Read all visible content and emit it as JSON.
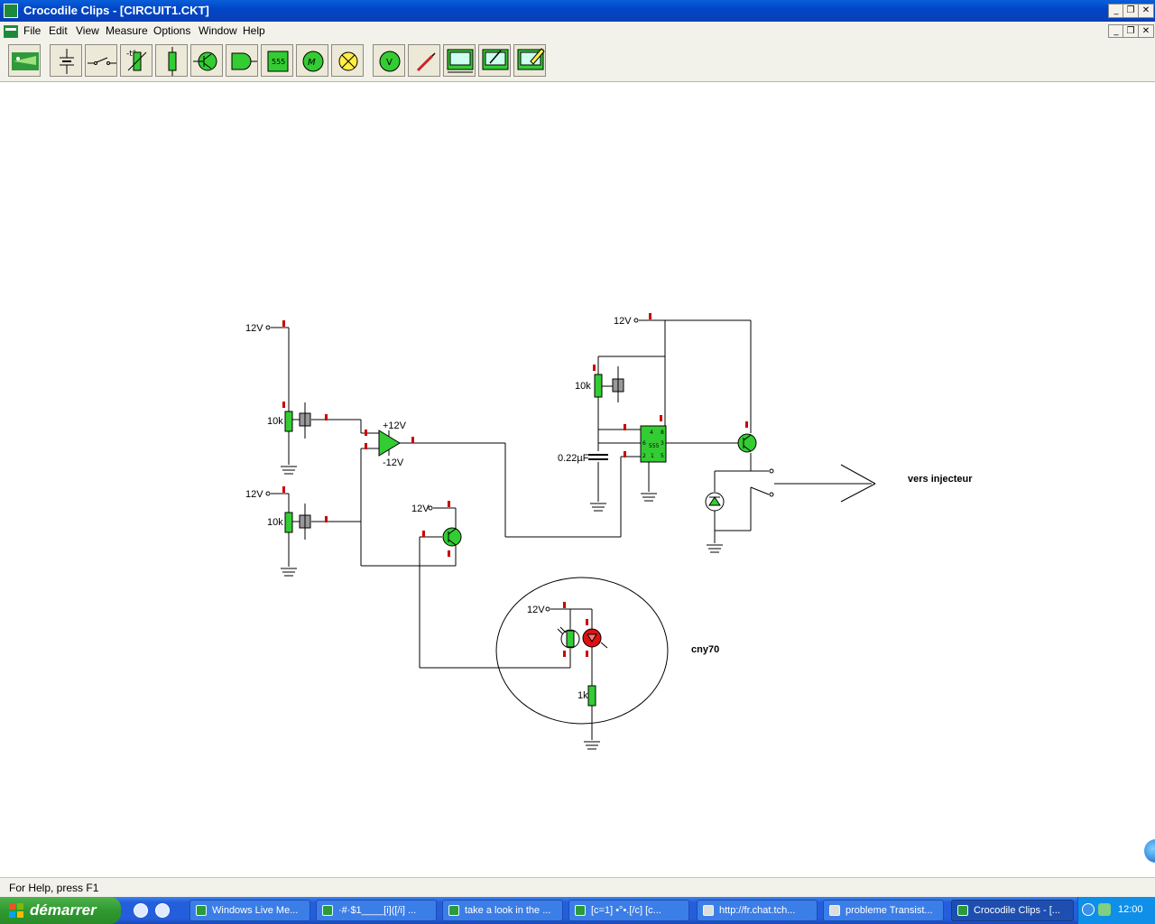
{
  "window": {
    "title": "Crocodile Clips - [CIRCUIT1.CKT]",
    "controls": [
      "minimize",
      "restore",
      "close"
    ]
  },
  "menu": {
    "items": [
      "File",
      "Edit",
      "View",
      "Measure",
      "Options",
      "Window",
      "Help"
    ]
  },
  "toolbar": {
    "chip_label": "555",
    "buttons": [
      "crocodile-logo-icon",
      "battery-icon",
      "switch-icon",
      "thermistor-icon",
      "resistor-icon",
      "transistor-icon",
      "logic-gate-icon",
      "chip-555-icon",
      "motor-icon",
      "lamp-icon",
      "voltmeter-icon",
      "probe-icon",
      "graph-icon",
      "graph-pen-icon",
      "graph-edit-icon"
    ]
  },
  "circuit": {
    "labels": {
      "v1": "12V",
      "v2": "12V",
      "v3": "12V",
      "v4": "12V",
      "v5": "12V",
      "r1": "10k",
      "r2": "10k",
      "r3": "10k",
      "opamp_plus": "+12V",
      "opamp_minus": "-12V",
      "cap": "0.22µF",
      "r4": "1k",
      "injector": "vers injecteur",
      "sensor": "cny70",
      "chip": "555",
      "chip_pins": [
        "4",
        "8",
        "3",
        "6",
        "2",
        "1",
        "5"
      ]
    },
    "colors": {
      "component_green": "#33cc33",
      "terminal_red": "#cc0000",
      "led_red": "#dd1111",
      "wire": "#000000"
    }
  },
  "statusbar": {
    "text": "For Help, press F1"
  },
  "taskbar": {
    "start_label": "démarrer",
    "tasks": [
      "Windows Live Me...",
      "·#·$1____[i]([/i] ...",
      "take a look in the ...",
      "[c=1] •°•.[/c] [c...",
      "http://fr.chat.tch...",
      "probleme Transist...",
      "Crocodile Clips - [..."
    ],
    "clock": "12:00"
  }
}
